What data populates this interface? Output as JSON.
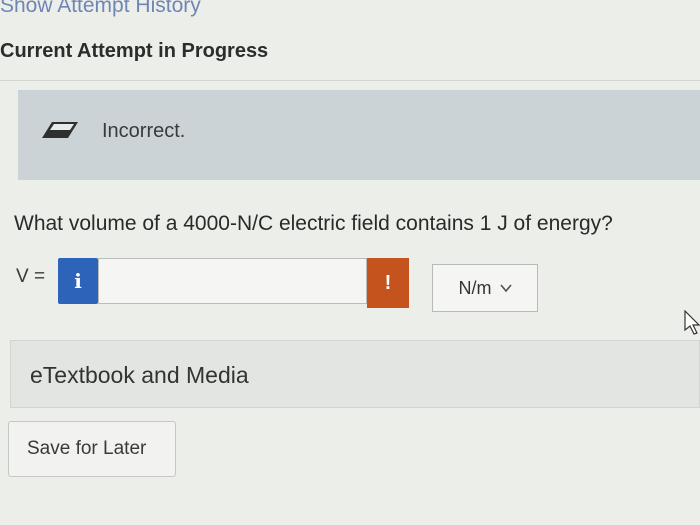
{
  "header": {
    "history_link": "Show Attempt History",
    "attempt_heading": "Current Attempt in Progress"
  },
  "feedback": {
    "text": "Incorrect.",
    "icon": "eraser-icon"
  },
  "question": {
    "prompt": "What volume of a 4000-N/C electric field contains 1 J of energy?",
    "variable_label": "V =",
    "info_button": "i",
    "error_button": "!",
    "answer_value": "",
    "unit_selected": "N/m"
  },
  "resources": {
    "etextbook_label": "eTextbook and Media"
  },
  "actions": {
    "save_label": "Save for Later"
  },
  "colors": {
    "info_blue": "#2d63b9",
    "error_orange": "#c5531d",
    "banner": "#ccd3d6",
    "link": "#6f86b4"
  }
}
